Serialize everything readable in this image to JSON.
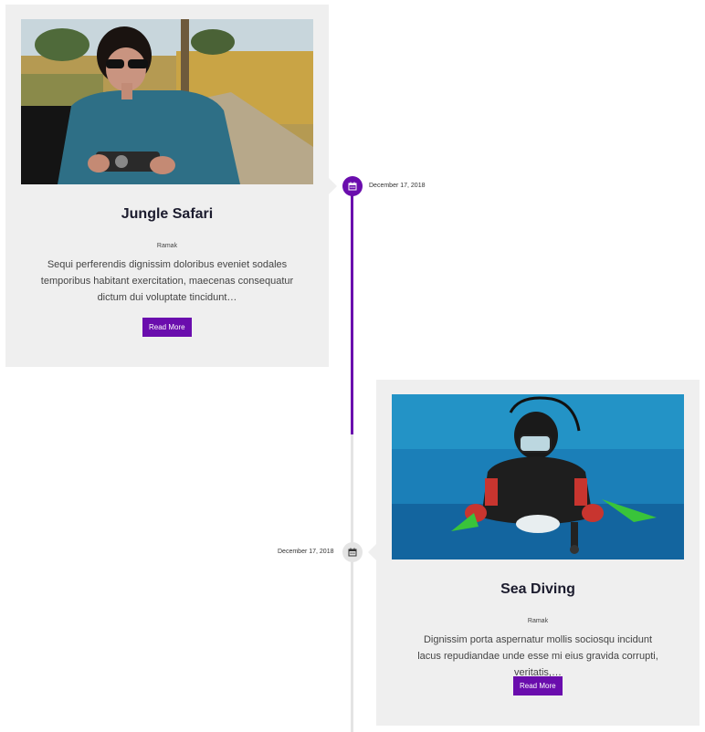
{
  "timeline": {
    "accent_color": "#6a0dad",
    "posts": [
      {
        "title": "Jungle Safari",
        "author": "Ramak",
        "excerpt": "Sequi perferendis dignissim doloribus eveniet sodales temporibus habitant exercitation, maecenas consequatur dictum dui voluptate tincidunt…",
        "button_label": "Read More",
        "date": "December 17, 2018",
        "icon": "calendar-icon"
      },
      {
        "title": "Sea Diving",
        "author": "Ramak",
        "excerpt": "Dignissim porta aspernatur mollis sociosqu incidunt lacus repudiandae unde esse mi eius gravida corrupti, veritatis,…",
        "button_label": "Read More",
        "date": "December 17, 2018",
        "icon": "calendar-icon"
      }
    ]
  }
}
